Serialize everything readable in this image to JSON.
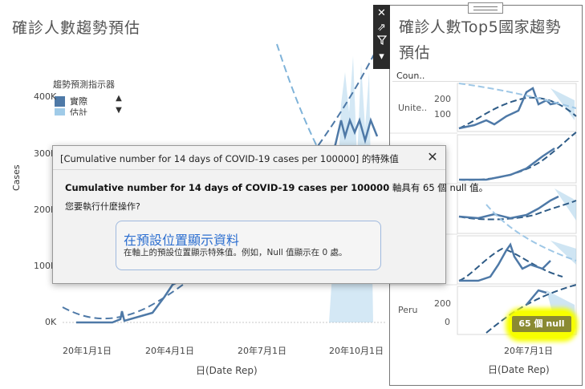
{
  "left_sheet": {
    "title": "確診人數趨勢預估",
    "legend": {
      "title": "趨勢預測指示器",
      "items": [
        {
          "label": "實際",
          "color": "#4e79a7"
        },
        {
          "label": "估計",
          "color": "#a0cbe8"
        }
      ]
    },
    "y_axis_label": "Cases",
    "y_ticks": [
      "400K",
      "300K",
      "200K",
      "100K",
      "0K"
    ],
    "x_axis_label": "日(Date Rep)",
    "x_ticks": [
      "20年1月1日",
      "20年4月1日",
      "20年7月1日",
      "20年10月1日"
    ]
  },
  "right_sheet": {
    "title": "確診人數Top5國家趨勢預估",
    "column_header": "Coun..",
    "rows": [
      {
        "label": "Unite..",
        "ticks": [
          "200",
          "100"
        ]
      },
      {
        "label": "",
        "ticks": []
      },
      {
        "label": "",
        "ticks": []
      },
      {
        "label": "",
        "ticks": []
      },
      {
        "label": "Peru",
        "ticks": [
          "200",
          "0"
        ]
      }
    ],
    "x_tick": "20年7月1日",
    "x_axis_label": "日(Date Rep)",
    "null_indicator": "65 個 null"
  },
  "toolbar": {
    "icons": [
      "close-icon",
      "popout-icon",
      "filter-icon",
      "dropdown-icon"
    ]
  },
  "dialog": {
    "title": "[Cumulative number for 14 days of COVID-19 cases per 100000] 的特殊值",
    "message_bold": "Cumulative number for 14 days of COVID-19 cases per 100000",
    "message_rest": " 軸具有 65 個 null 值。",
    "question": "您要執行什麼操作?",
    "option_title": "在預設位置顯示資料",
    "option_desc": "在軸上的預設位置顯示特殊值。例如，Null 值顯示在 0 處。"
  },
  "colors": {
    "actual": "#4e79a7",
    "estimate": "#a0cbe8",
    "highlight": "#f7ff00",
    "link_blue": "#2d6fd0"
  }
}
